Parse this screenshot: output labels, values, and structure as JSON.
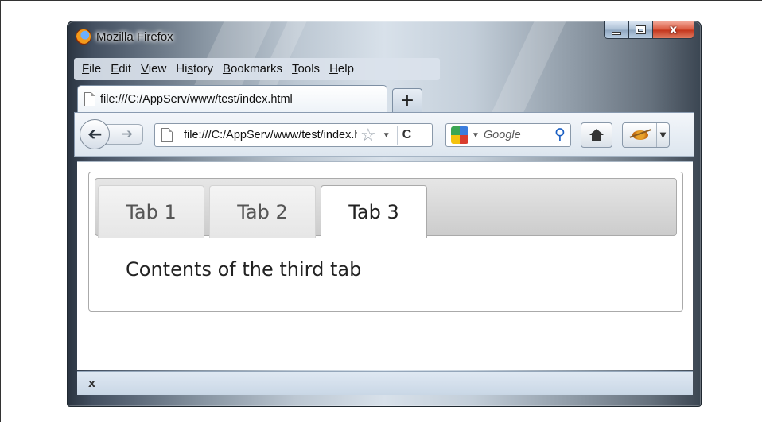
{
  "window": {
    "title": "Mozilla Firefox",
    "close_glyph": "x"
  },
  "menu": [
    {
      "underline": "F",
      "rest": "ile"
    },
    {
      "underline": "E",
      "rest": "dit"
    },
    {
      "underline": "V",
      "rest": "iew"
    },
    {
      "pre": "Hi",
      "underline": "s",
      "rest": "tory"
    },
    {
      "underline": "B",
      "rest": "ookmarks"
    },
    {
      "underline": "T",
      "rest": "ools"
    },
    {
      "underline": "H",
      "rest": "elp"
    }
  ],
  "browser_tab": {
    "title": "file:///C:/AppServ/www/test/index.html",
    "new_tab_label": "+"
  },
  "navigation": {
    "url": "file:///C:/AppServ/www/test/index.html",
    "search_placeholder": "Google"
  },
  "widget": {
    "tabs": [
      {
        "label": "Tab 1",
        "active": false
      },
      {
        "label": "Tab 2",
        "active": false
      },
      {
        "label": "Tab 3",
        "active": true
      }
    ],
    "panel_text": "Contents of the third tab"
  },
  "findbar": {
    "close_label": "x"
  }
}
